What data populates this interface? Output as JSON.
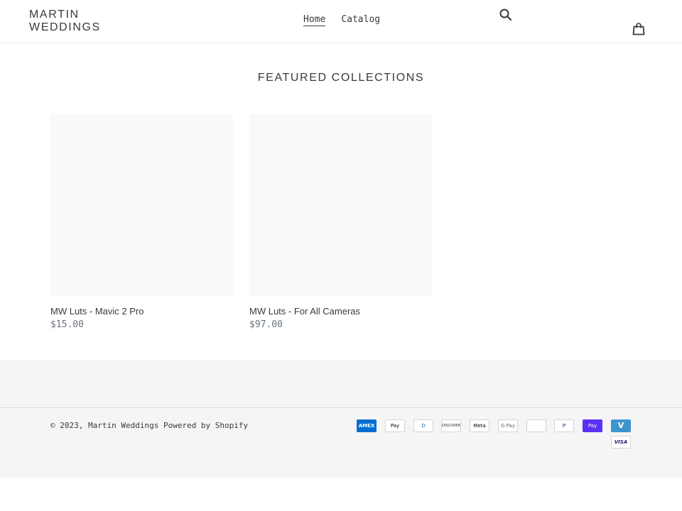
{
  "header": {
    "logo_line1": "MARTIN",
    "logo_line2": "WEDDINGS",
    "nav": [
      {
        "label": "Home"
      },
      {
        "label": "Catalog"
      }
    ]
  },
  "main": {
    "section_title": "FEATURED COLLECTIONS",
    "products": [
      {
        "title": "MW Luts - Mavic 2 Pro",
        "price": "$15.00"
      },
      {
        "title": "MW Luts - For All Cameras",
        "price": "$97.00"
      }
    ]
  },
  "footer": {
    "copyright_prefix": "© 2023,",
    "shop_name": "Martin Weddings",
    "powered_by": "Powered by Shopify",
    "payments": [
      {
        "name": "amex-icon",
        "label": "AMEX",
        "bg": "#016fd0",
        "fg": "#ffffff"
      },
      {
        "name": "apple-pay-icon",
        "label": "Pay",
        "bg": "#ffffff",
        "fg": "#000000"
      },
      {
        "name": "diners-club-icon",
        "label": "D",
        "bg": "#ffffff",
        "fg": "#0079be"
      },
      {
        "name": "discover-icon",
        "label": "DISCOVER",
        "bg": "#ffffff",
        "fg": "#231f20"
      },
      {
        "name": "meta-pay-icon",
        "label": "Meta",
        "bg": "#ffffff",
        "fg": "#000000"
      },
      {
        "name": "google-pay-icon",
        "label": "G Pay",
        "bg": "#ffffff",
        "fg": "#5f6368"
      },
      {
        "name": "mastercard-icon",
        "label": "",
        "bg": "#ffffff",
        "fg": "#eb001b"
      },
      {
        "name": "paypal-icon",
        "label": "P",
        "bg": "#ffffff",
        "fg": "#003087"
      },
      {
        "name": "shop-pay-icon",
        "label": "Pay",
        "bg": "#5a31f4",
        "fg": "#ffffff"
      },
      {
        "name": "venmo-icon",
        "label": "V",
        "bg": "#3d95ce",
        "fg": "#ffffff"
      },
      {
        "name": "visa-icon",
        "label": "VISA",
        "bg": "#ffffff",
        "fg": "#1a1f71"
      }
    ]
  }
}
